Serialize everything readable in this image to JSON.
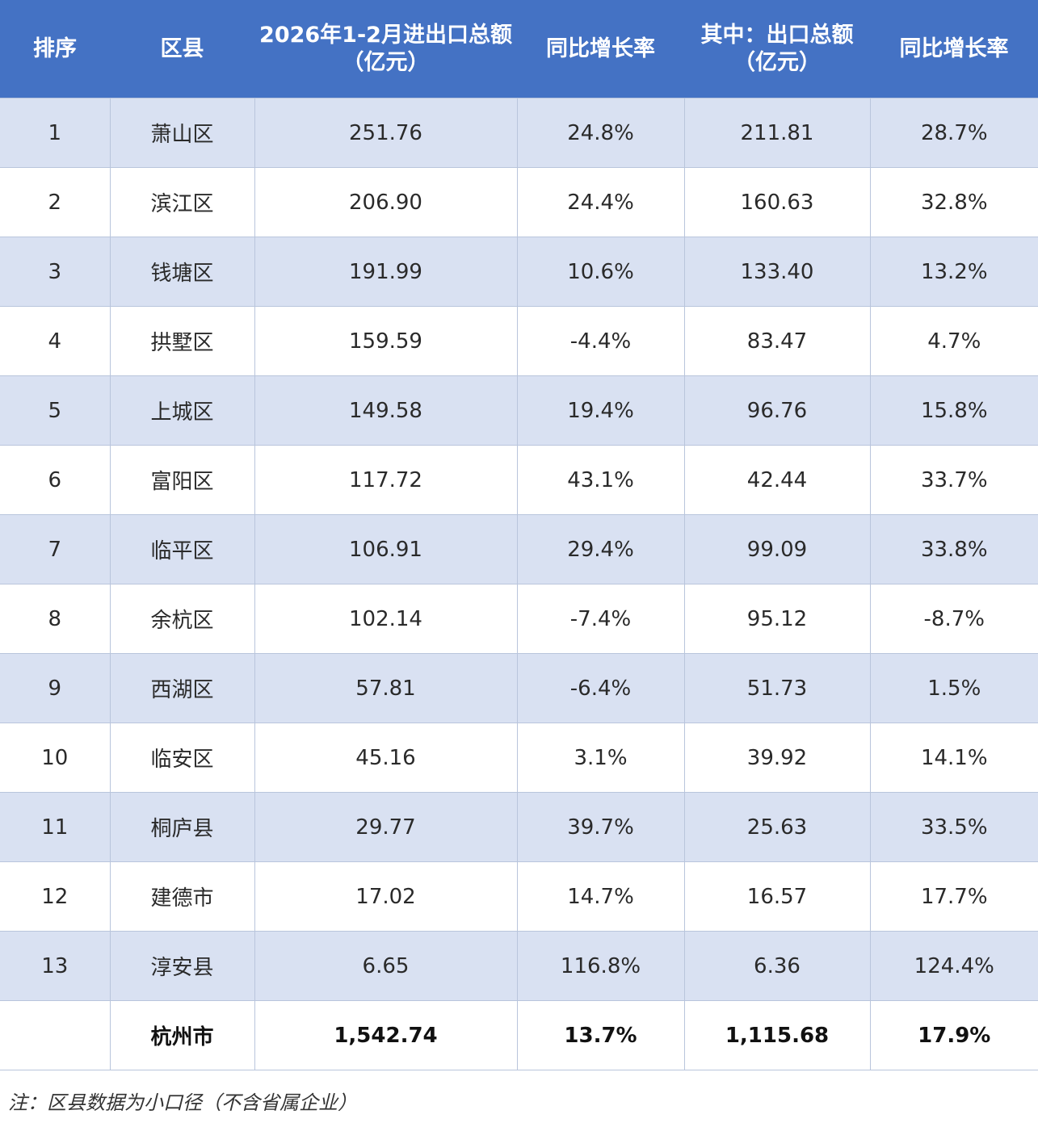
{
  "headers": [
    {
      "line1": "排序",
      "line2": ""
    },
    {
      "line1": "区县",
      "line2": ""
    },
    {
      "line1": "2026年1-2月进出口总额",
      "line2": "（亿元）"
    },
    {
      "line1": "同比增长率",
      "line2": ""
    },
    {
      "line1": "其中：出口总额",
      "line2": "（亿元）"
    },
    {
      "line1": "同比增长率",
      "line2": ""
    }
  ],
  "rows": [
    {
      "rank": "1",
      "district": "萧山区",
      "total": "251.76",
      "total_growth": "24.8%",
      "export": "211.81",
      "export_growth": "28.7%"
    },
    {
      "rank": "2",
      "district": "滨江区",
      "total": "206.90",
      "total_growth": "24.4%",
      "export": "160.63",
      "export_growth": "32.8%"
    },
    {
      "rank": "3",
      "district": "钱塘区",
      "total": "191.99",
      "total_growth": "10.6%",
      "export": "133.40",
      "export_growth": "13.2%"
    },
    {
      "rank": "4",
      "district": "拱墅区",
      "total": "159.59",
      "total_growth": "-4.4%",
      "export": "83.47",
      "export_growth": "4.7%"
    },
    {
      "rank": "5",
      "district": "上城区",
      "total": "149.58",
      "total_growth": "19.4%",
      "export": "96.76",
      "export_growth": "15.8%"
    },
    {
      "rank": "6",
      "district": "富阳区",
      "total": "117.72",
      "total_growth": "43.1%",
      "export": "42.44",
      "export_growth": "33.7%"
    },
    {
      "rank": "7",
      "district": "临平区",
      "total": "106.91",
      "total_growth": "29.4%",
      "export": "99.09",
      "export_growth": "33.8%"
    },
    {
      "rank": "8",
      "district": "余杭区",
      "total": "102.14",
      "total_growth": "-7.4%",
      "export": "95.12",
      "export_growth": "-8.7%"
    },
    {
      "rank": "9",
      "district": "西湖区",
      "total": "57.81",
      "total_growth": "-6.4%",
      "export": "51.73",
      "export_growth": "1.5%"
    },
    {
      "rank": "10",
      "district": "临安区",
      "total": "45.16",
      "total_growth": "3.1%",
      "export": "39.92",
      "export_growth": "14.1%"
    },
    {
      "rank": "11",
      "district": "桐庐县",
      "total": "29.77",
      "total_growth": "39.7%",
      "export": "25.63",
      "export_growth": "33.5%"
    },
    {
      "rank": "12",
      "district": "建德市",
      "total": "17.02",
      "total_growth": "14.7%",
      "export": "16.57",
      "export_growth": "17.7%"
    },
    {
      "rank": "13",
      "district": "淳安县",
      "total": "6.65",
      "total_growth": "116.8%",
      "export": "6.36",
      "export_growth": "124.4%"
    }
  ],
  "total_row": {
    "rank": "",
    "district": "杭州市",
    "total": "1,542.74",
    "total_growth": "13.7%",
    "export": "1,115.68",
    "export_growth": "17.9%"
  },
  "note": "注：区县数据为小口径（不含省属企业）",
  "colors": {
    "header_bg": "#4472c4",
    "band_bg": "#d9e1f2",
    "grid": "#b9c5dc"
  }
}
